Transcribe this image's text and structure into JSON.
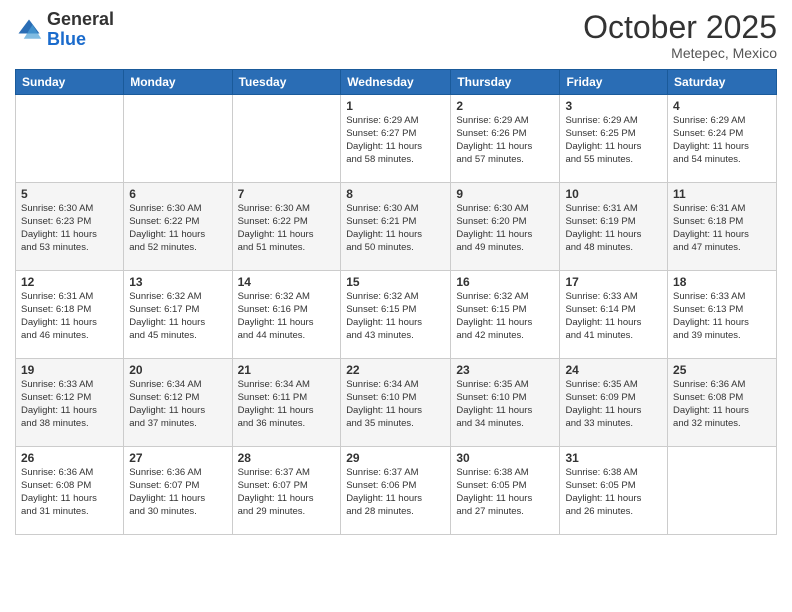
{
  "logo": {
    "general": "General",
    "blue": "Blue"
  },
  "header": {
    "month": "October 2025",
    "location": "Metepec, Mexico"
  },
  "weekdays": [
    "Sunday",
    "Monday",
    "Tuesday",
    "Wednesday",
    "Thursday",
    "Friday",
    "Saturday"
  ],
  "weeks": [
    [
      {
        "day": "",
        "info": ""
      },
      {
        "day": "",
        "info": ""
      },
      {
        "day": "",
        "info": ""
      },
      {
        "day": "1",
        "info": "Sunrise: 6:29 AM\nSunset: 6:27 PM\nDaylight: 11 hours\nand 58 minutes."
      },
      {
        "day": "2",
        "info": "Sunrise: 6:29 AM\nSunset: 6:26 PM\nDaylight: 11 hours\nand 57 minutes."
      },
      {
        "day": "3",
        "info": "Sunrise: 6:29 AM\nSunset: 6:25 PM\nDaylight: 11 hours\nand 55 minutes."
      },
      {
        "day": "4",
        "info": "Sunrise: 6:29 AM\nSunset: 6:24 PM\nDaylight: 11 hours\nand 54 minutes."
      }
    ],
    [
      {
        "day": "5",
        "info": "Sunrise: 6:30 AM\nSunset: 6:23 PM\nDaylight: 11 hours\nand 53 minutes."
      },
      {
        "day": "6",
        "info": "Sunrise: 6:30 AM\nSunset: 6:22 PM\nDaylight: 11 hours\nand 52 minutes."
      },
      {
        "day": "7",
        "info": "Sunrise: 6:30 AM\nSunset: 6:22 PM\nDaylight: 11 hours\nand 51 minutes."
      },
      {
        "day": "8",
        "info": "Sunrise: 6:30 AM\nSunset: 6:21 PM\nDaylight: 11 hours\nand 50 minutes."
      },
      {
        "day": "9",
        "info": "Sunrise: 6:30 AM\nSunset: 6:20 PM\nDaylight: 11 hours\nand 49 minutes."
      },
      {
        "day": "10",
        "info": "Sunrise: 6:31 AM\nSunset: 6:19 PM\nDaylight: 11 hours\nand 48 minutes."
      },
      {
        "day": "11",
        "info": "Sunrise: 6:31 AM\nSunset: 6:18 PM\nDaylight: 11 hours\nand 47 minutes."
      }
    ],
    [
      {
        "day": "12",
        "info": "Sunrise: 6:31 AM\nSunset: 6:18 PM\nDaylight: 11 hours\nand 46 minutes."
      },
      {
        "day": "13",
        "info": "Sunrise: 6:32 AM\nSunset: 6:17 PM\nDaylight: 11 hours\nand 45 minutes."
      },
      {
        "day": "14",
        "info": "Sunrise: 6:32 AM\nSunset: 6:16 PM\nDaylight: 11 hours\nand 44 minutes."
      },
      {
        "day": "15",
        "info": "Sunrise: 6:32 AM\nSunset: 6:15 PM\nDaylight: 11 hours\nand 43 minutes."
      },
      {
        "day": "16",
        "info": "Sunrise: 6:32 AM\nSunset: 6:15 PM\nDaylight: 11 hours\nand 42 minutes."
      },
      {
        "day": "17",
        "info": "Sunrise: 6:33 AM\nSunset: 6:14 PM\nDaylight: 11 hours\nand 41 minutes."
      },
      {
        "day": "18",
        "info": "Sunrise: 6:33 AM\nSunset: 6:13 PM\nDaylight: 11 hours\nand 39 minutes."
      }
    ],
    [
      {
        "day": "19",
        "info": "Sunrise: 6:33 AM\nSunset: 6:12 PM\nDaylight: 11 hours\nand 38 minutes."
      },
      {
        "day": "20",
        "info": "Sunrise: 6:34 AM\nSunset: 6:12 PM\nDaylight: 11 hours\nand 37 minutes."
      },
      {
        "day": "21",
        "info": "Sunrise: 6:34 AM\nSunset: 6:11 PM\nDaylight: 11 hours\nand 36 minutes."
      },
      {
        "day": "22",
        "info": "Sunrise: 6:34 AM\nSunset: 6:10 PM\nDaylight: 11 hours\nand 35 minutes."
      },
      {
        "day": "23",
        "info": "Sunrise: 6:35 AM\nSunset: 6:10 PM\nDaylight: 11 hours\nand 34 minutes."
      },
      {
        "day": "24",
        "info": "Sunrise: 6:35 AM\nSunset: 6:09 PM\nDaylight: 11 hours\nand 33 minutes."
      },
      {
        "day": "25",
        "info": "Sunrise: 6:36 AM\nSunset: 6:08 PM\nDaylight: 11 hours\nand 32 minutes."
      }
    ],
    [
      {
        "day": "26",
        "info": "Sunrise: 6:36 AM\nSunset: 6:08 PM\nDaylight: 11 hours\nand 31 minutes."
      },
      {
        "day": "27",
        "info": "Sunrise: 6:36 AM\nSunset: 6:07 PM\nDaylight: 11 hours\nand 30 minutes."
      },
      {
        "day": "28",
        "info": "Sunrise: 6:37 AM\nSunset: 6:07 PM\nDaylight: 11 hours\nand 29 minutes."
      },
      {
        "day": "29",
        "info": "Sunrise: 6:37 AM\nSunset: 6:06 PM\nDaylight: 11 hours\nand 28 minutes."
      },
      {
        "day": "30",
        "info": "Sunrise: 6:38 AM\nSunset: 6:05 PM\nDaylight: 11 hours\nand 27 minutes."
      },
      {
        "day": "31",
        "info": "Sunrise: 6:38 AM\nSunset: 6:05 PM\nDaylight: 11 hours\nand 26 minutes."
      },
      {
        "day": "",
        "info": ""
      }
    ]
  ]
}
